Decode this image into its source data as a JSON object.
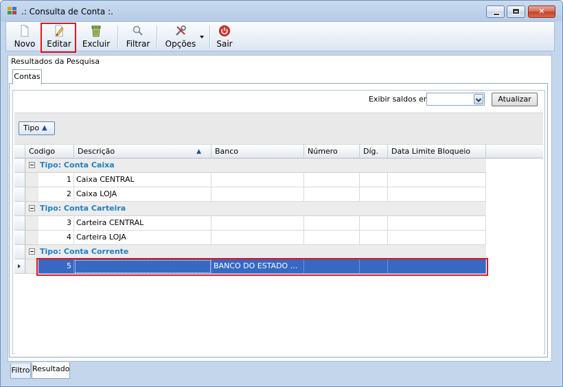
{
  "window": {
    "title": ".: Consulta de Conta :."
  },
  "toolbar": {
    "novo": "Novo",
    "editar": "Editar",
    "excluir": "Excluir",
    "filtrar": "Filtrar",
    "opcoes": "Opções",
    "sair": "Sair"
  },
  "group": {
    "title": "Resultados da Pesquisa"
  },
  "tabs": {
    "contas": "Contas"
  },
  "filters": {
    "saldos_label": "Exibir saldos em:",
    "saldos_value": "",
    "atualizar": "Atualizar"
  },
  "groupby": {
    "chip": "Tipo"
  },
  "grid": {
    "columns": [
      "Codigo",
      "Descrição",
      "Banco",
      "Número",
      "Díg.",
      "Data Limite Bloqueio"
    ],
    "groups": [
      {
        "label": "Tipo: Conta Caixa",
        "rows": [
          {
            "codigo": "1",
            "descricao": "Caixa CENTRAL",
            "banco": ""
          },
          {
            "codigo": "2",
            "descricao": "Caixa LOJA",
            "banco": ""
          }
        ]
      },
      {
        "label": "Tipo: Conta Carteira",
        "rows": [
          {
            "codigo": "3",
            "descricao": "Carteira CENTRAL",
            "banco": ""
          },
          {
            "codigo": "4",
            "descricao": "Carteira LOJA",
            "banco": ""
          }
        ]
      },
      {
        "label": "Tipo: Conta Corrente",
        "rows": [
          {
            "codigo": "5",
            "descricao": "",
            "banco": "BANCO DO ESTADO DO ..."
          }
        ]
      }
    ]
  },
  "bottom_tabs": {
    "filtro": "Filtro",
    "resultado": "Resultado"
  },
  "colors": {
    "selection": "#3569c2",
    "group_text": "#1f7fc4",
    "highlight": "#e1141e"
  }
}
